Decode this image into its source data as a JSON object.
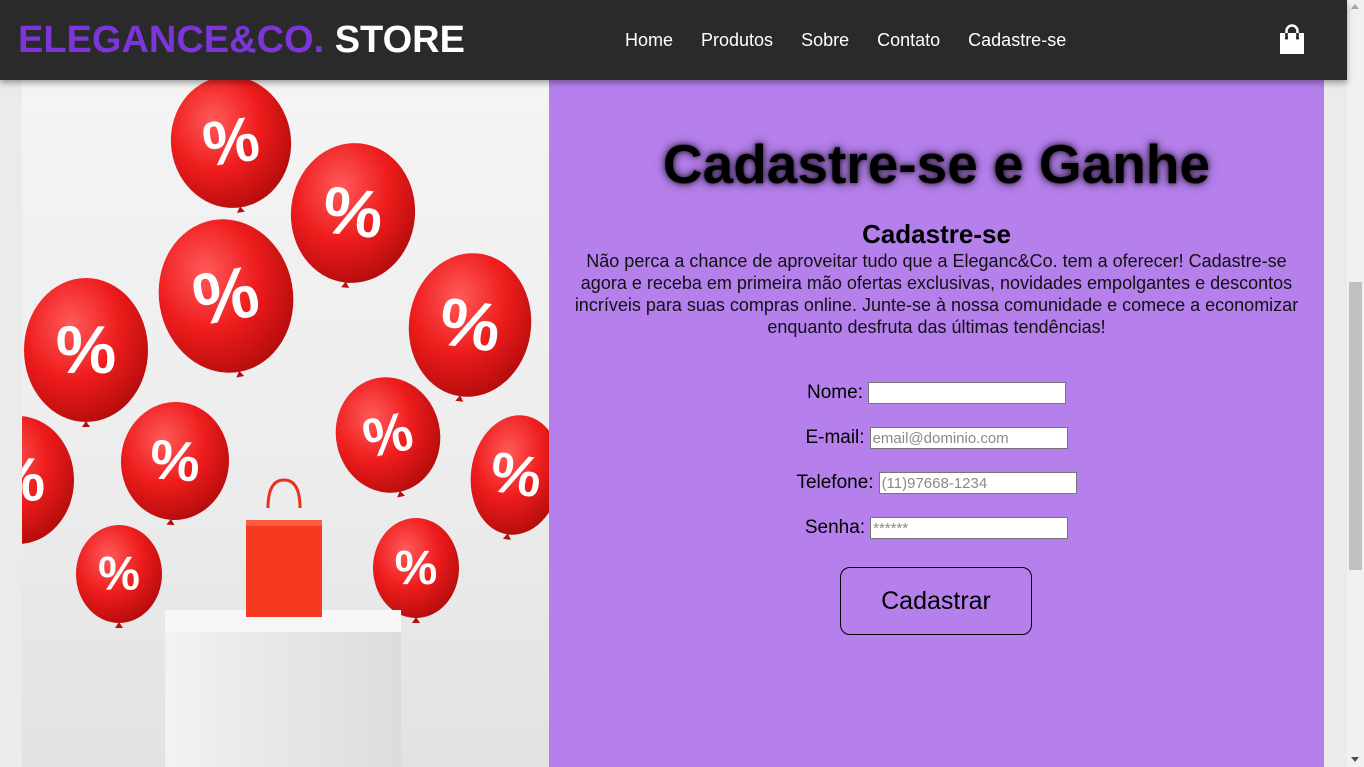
{
  "brand": {
    "part1": "ELEGANCE&CO.",
    "part2": "STORE",
    "accent_color": "#7b35d8"
  },
  "nav": {
    "items": [
      {
        "label": "Home"
      },
      {
        "label": "Produtos"
      },
      {
        "label": "Sobre"
      },
      {
        "label": "Contato"
      },
      {
        "label": "Cadastre-se"
      }
    ],
    "cart_icon": "shopping-bag-icon"
  },
  "hero": {
    "image": "red-percent-balloons-with-shopping-bag",
    "balloon_mark": "%"
  },
  "signup": {
    "headline": "Cadastre-se e Ganhe",
    "subtitle": "Cadastre-se",
    "description": "Não perca a chance de aproveitar tudo que a Eleganc&Co. tem a oferecer! Cadastre-se agora e receba em primeira mão ofertas exclusivas, novidades empolgantes e descontos incríveis para suas compras online. Junte-se à nossa comunidade e comece a economizar enquanto desfruta das últimas tendências!",
    "panel_color": "#b57fec",
    "fields": {
      "name": {
        "label": "Nome:",
        "placeholder": "",
        "value": ""
      },
      "email": {
        "label": "E-mail:",
        "placeholder": "email@dominio.com",
        "value": ""
      },
      "phone": {
        "label": "Telefone:",
        "placeholder": "(11)97668-1234",
        "value": ""
      },
      "password": {
        "label": "Senha:",
        "placeholder": "******",
        "value": ""
      }
    },
    "submit_label": "Cadastrar"
  }
}
